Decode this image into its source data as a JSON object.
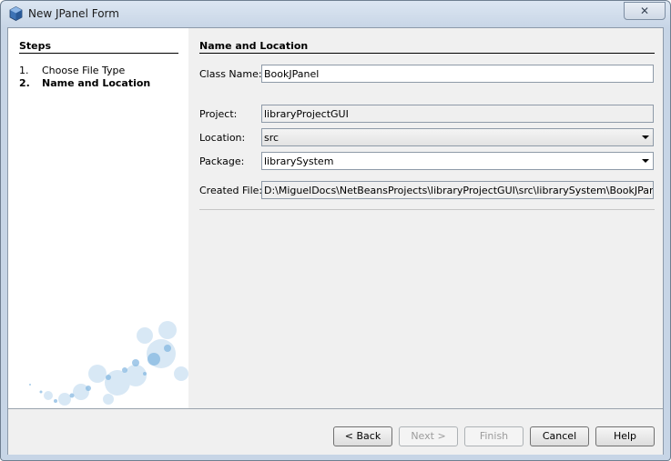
{
  "window": {
    "title": "New JPanel Form",
    "close_glyph": "✕"
  },
  "steps": {
    "title": "Steps",
    "items": [
      {
        "num": "1.",
        "label": "Choose File Type"
      },
      {
        "num": "2.",
        "label": "Name and Location"
      }
    ]
  },
  "form": {
    "title": "Name and Location",
    "class_name": {
      "label": "Class Name:",
      "value": "BookJPanel"
    },
    "project": {
      "label": "Project:",
      "value": "libraryProjectGUI"
    },
    "location": {
      "label": "Location:",
      "value": "src"
    },
    "package": {
      "label": "Package:",
      "value": "librarySystem"
    },
    "created_file": {
      "label": "Created File:",
      "value": "D:\\MiguelDocs\\NetBeansProjects\\libraryProjectGUI\\src\\librarySystem\\BookJPanel.java"
    }
  },
  "buttons": {
    "back": "< Back",
    "next": "Next >",
    "finish": "Finish",
    "cancel": "Cancel",
    "help": "Help"
  },
  "colors": {
    "title_bar": "#c7d5e6",
    "panel": "#f0f0f0"
  }
}
